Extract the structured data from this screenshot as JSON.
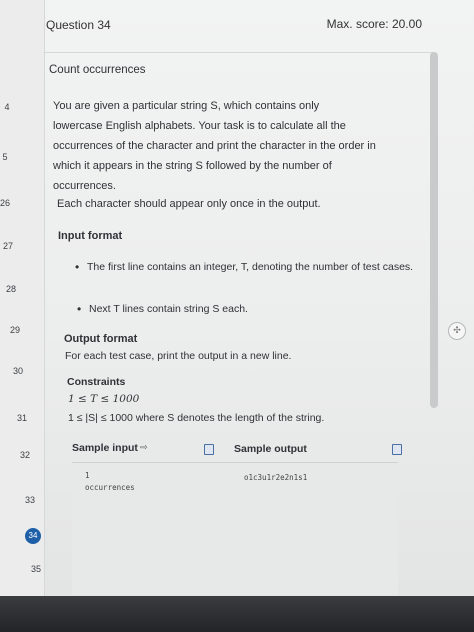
{
  "header": {
    "question_label": "Question 34",
    "max_score": "Max. score: 20.00"
  },
  "qnav": {
    "numbers": [
      "4",
      "5",
      "26",
      "27",
      "28",
      "29",
      "30",
      "31",
      "32",
      "33",
      "34",
      "35"
    ],
    "active": "34"
  },
  "problem": {
    "title": "Count occurrences",
    "desc_lines": [
      "You are given a particular string S, which contains only",
      "lowercase English alphabets. Your task is to calculate all the",
      "occurrences of the character and print the character in the order in",
      "which it appears in the string S followed by the number of",
      "occurrences."
    ],
    "desc_extra": "Each character should appear only once in the output."
  },
  "input_format": {
    "heading": "Input format",
    "bullets": [
      "The first line contains an integer, T, denoting the number of test cases.",
      "Next T lines contain string S each."
    ]
  },
  "output_format": {
    "heading": "Output format",
    "text": "For each test case, print the output in a new line."
  },
  "constraints": {
    "heading": "Constraints",
    "line1": "1 ≤ T ≤ 1000",
    "line2": "1 ≤ |S| ≤ 1000 where S denotes the length of the string."
  },
  "samples": {
    "input_label": "Sample input",
    "output_label": "Sample output",
    "input_line1": "1",
    "input_line2": "occurrences",
    "output_line1": "o1c3u1r2e2n1s1"
  },
  "colors": {
    "accent": "#1f5fa8",
    "background": "#f2f3f3"
  }
}
